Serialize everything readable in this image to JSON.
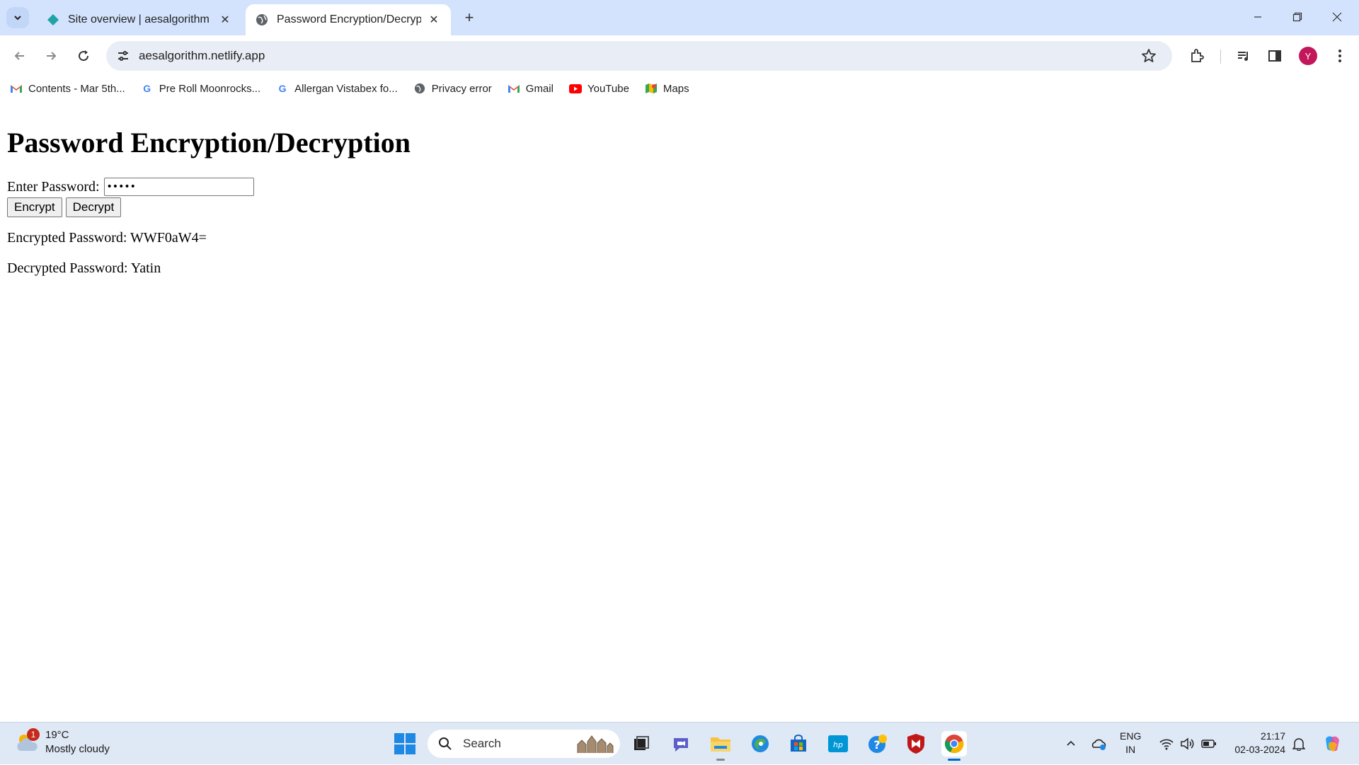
{
  "browser": {
    "tabs": [
      {
        "title": "Site overview | aesalgorithm | N",
        "active": false
      },
      {
        "title": "Password Encryption/Decryption",
        "active": true
      }
    ],
    "url": "aesalgorithm.netlify.app",
    "profile_initial": "Y"
  },
  "bookmarks": [
    {
      "label": "Contents - Mar 5th...",
      "icon": "gmail-icon"
    },
    {
      "label": "Pre Roll Moonrocks...",
      "icon": "google-icon"
    },
    {
      "label": "Allergan Vistabex fo...",
      "icon": "google-icon"
    },
    {
      "label": "Privacy error",
      "icon": "globe-icon"
    },
    {
      "label": "Gmail",
      "icon": "gmail-icon"
    },
    {
      "label": "YouTube",
      "icon": "youtube-icon"
    },
    {
      "label": "Maps",
      "icon": "maps-icon"
    }
  ],
  "page": {
    "heading": "Password Encryption/Decryption",
    "password_label": "Enter Password:",
    "password_value": "Yatin",
    "encrypt_label": "Encrypt",
    "decrypt_label": "Decrypt",
    "encrypted_text": "Encrypted Password: WWF0aW4=",
    "decrypted_text": "Decrypted Password: Yatin"
  },
  "taskbar": {
    "weather_temp": "19°C",
    "weather_desc": "Mostly cloudy",
    "weather_badge": "1",
    "search_placeholder": "Search",
    "lang_line1": "ENG",
    "lang_line2": "IN",
    "time": "21:17",
    "date": "02-03-2024"
  },
  "colors": {
    "tabstrip": "#d3e3fd",
    "omnibox": "#e9eef6",
    "taskbar": "#dfe8f5",
    "avatar": "#c2185b"
  }
}
